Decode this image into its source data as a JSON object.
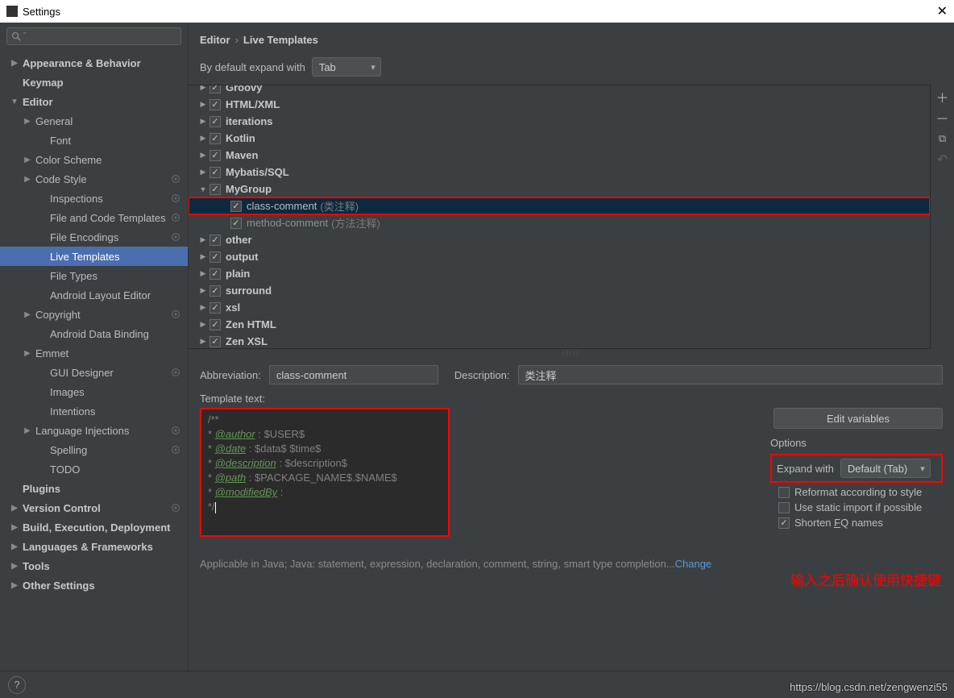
{
  "window_title": "Settings",
  "search_placeholder": "Q-",
  "sidebar": [
    {
      "label": "Appearance & Behavior",
      "lvl": 0,
      "bold": true,
      "arr": "closed"
    },
    {
      "label": "Keymap",
      "lvl": 0,
      "bold": true
    },
    {
      "label": "Editor",
      "lvl": 0,
      "bold": true,
      "arr": "open"
    },
    {
      "label": "General",
      "lvl": 1,
      "arr": "closed"
    },
    {
      "label": "Font",
      "lvl": 2
    },
    {
      "label": "Color Scheme",
      "lvl": 1,
      "arr": "closed"
    },
    {
      "label": "Code Style",
      "lvl": 1,
      "arr": "closed",
      "gear": true
    },
    {
      "label": "Inspections",
      "lvl": 2,
      "gear": true
    },
    {
      "label": "File and Code Templates",
      "lvl": 2,
      "gear": true
    },
    {
      "label": "File Encodings",
      "lvl": 2,
      "gear": true
    },
    {
      "label": "Live Templates",
      "lvl": 2,
      "selected": true
    },
    {
      "label": "File Types",
      "lvl": 2
    },
    {
      "label": "Android Layout Editor",
      "lvl": 2
    },
    {
      "label": "Copyright",
      "lvl": 1,
      "arr": "closed",
      "gear": true
    },
    {
      "label": "Android Data Binding",
      "lvl": 2
    },
    {
      "label": "Emmet",
      "lvl": 1,
      "arr": "closed"
    },
    {
      "label": "GUI Designer",
      "lvl": 2,
      "gear": true
    },
    {
      "label": "Images",
      "lvl": 2
    },
    {
      "label": "Intentions",
      "lvl": 2
    },
    {
      "label": "Language Injections",
      "lvl": 1,
      "arr": "closed",
      "gear": true
    },
    {
      "label": "Spelling",
      "lvl": 2,
      "gear": true
    },
    {
      "label": "TODO",
      "lvl": 2
    },
    {
      "label": "Plugins",
      "lvl": 0,
      "bold": true
    },
    {
      "label": "Version Control",
      "lvl": 0,
      "bold": true,
      "arr": "closed",
      "gear": true
    },
    {
      "label": "Build, Execution, Deployment",
      "lvl": 0,
      "bold": true,
      "arr": "closed"
    },
    {
      "label": "Languages & Frameworks",
      "lvl": 0,
      "bold": true,
      "arr": "closed"
    },
    {
      "label": "Tools",
      "lvl": 0,
      "bold": true,
      "arr": "closed"
    },
    {
      "label": "Other Settings",
      "lvl": 0,
      "bold": true,
      "arr": "closed"
    }
  ],
  "breadcrumb": {
    "root": "Editor",
    "sep": "›",
    "leaf": "Live Templates"
  },
  "expand_label": "By default expand with",
  "expand_value": "Tab",
  "groups": [
    {
      "label": "Groovy",
      "lvl": 1,
      "arr": "closed",
      "checked": true,
      "cut": true
    },
    {
      "label": "HTML/XML",
      "lvl": 1,
      "arr": "closed",
      "checked": true
    },
    {
      "label": "iterations",
      "lvl": 1,
      "arr": "closed",
      "checked": true
    },
    {
      "label": "Kotlin",
      "lvl": 1,
      "arr": "closed",
      "checked": true
    },
    {
      "label": "Maven",
      "lvl": 1,
      "arr": "closed",
      "checked": true
    },
    {
      "label": "Mybatis/SQL",
      "lvl": 1,
      "arr": "closed",
      "checked": true
    },
    {
      "label": "MyGroup",
      "lvl": 1,
      "arr": "open",
      "checked": true
    },
    {
      "label": "class-comment",
      "hint": "(类注释)",
      "lvl": 2,
      "checked": true,
      "selected": true,
      "hl": true
    },
    {
      "label": "method-comment",
      "hint": "(方法注释)",
      "lvl": 2,
      "checked": true,
      "dim": true
    },
    {
      "label": "other",
      "lvl": 1,
      "arr": "closed",
      "checked": true
    },
    {
      "label": "output",
      "lvl": 1,
      "arr": "closed",
      "checked": true
    },
    {
      "label": "plain",
      "lvl": 1,
      "arr": "closed",
      "checked": true
    },
    {
      "label": "surround",
      "lvl": 1,
      "arr": "closed",
      "checked": true
    },
    {
      "label": "xsl",
      "lvl": 1,
      "arr": "closed",
      "checked": true
    },
    {
      "label": "Zen HTML",
      "lvl": 1,
      "arr": "closed",
      "checked": true
    },
    {
      "label": "Zen XSL",
      "lvl": 1,
      "arr": "closed",
      "checked": true
    }
  ],
  "abbr_label": "Abbreviation:",
  "abbr_value": "class-comment",
  "desc_label": "Description:",
  "desc_value": "类注释",
  "tmpl_label": "Template text:",
  "template": {
    "l1": "/**",
    "l2a": " * ",
    "l2b": "@author",
    "l2c": " : $USER$",
    "l3a": " * ",
    "l3b": "@date",
    "l3c": " : $data$ $time$",
    "l4a": " * ",
    "l4b": "@description",
    "l4c": " : $description$",
    "l5a": " * ",
    "l5b": "@path",
    "l5c": " : $PACKAGE_NAME$.$NAME$",
    "l6a": " * ",
    "l6b": "@modifiedBy",
    "l6c": " :",
    "l7": " */"
  },
  "edit_vars_label": "Edit variables",
  "options_title": "Options",
  "expand_with_label": "Expand with",
  "expand_with_value": "Default (Tab)",
  "opt1": "Reformat according to style",
  "opt2": "Use static import if possible",
  "opt3_a": "Shorten ",
  "opt3_b": "F",
  "opt3_c": "Q names",
  "applicable_text": "Applicable in Java; Java: statement, expression, declaration, comment, string, smart type completion...",
  "change_link": "Change",
  "annotation_text": "输入之后确认使用快捷键",
  "watermark": "https://blog.csdn.net/zengwenzi55"
}
